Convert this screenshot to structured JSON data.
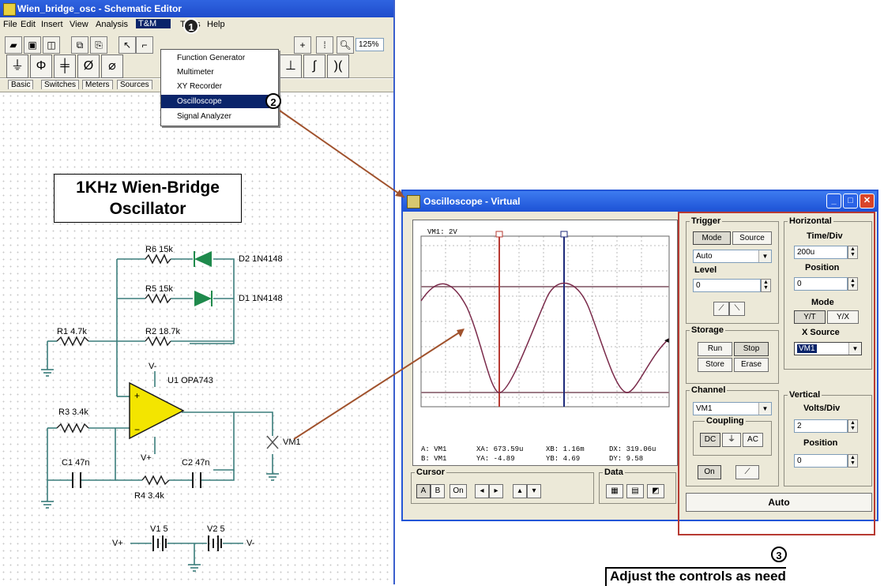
{
  "editor": {
    "title": "Wien_bridge_osc - Schematic Editor",
    "menu": [
      "File",
      "Edit",
      "Insert",
      "View",
      "Analysis",
      "T&M",
      "Tools",
      "Help"
    ],
    "zoom": "125%",
    "tabs": [
      "Basic",
      "Switches",
      "Meters",
      "Sources"
    ],
    "tm_menu": {
      "items": [
        "Function Generator",
        "Multimeter",
        "XY Recorder",
        "Oscilloscope",
        "Signal Analyzer"
      ],
      "selected": "Oscilloscope"
    }
  },
  "schematic": {
    "title_line1": "1KHz Wien-Bridge",
    "title_line2": "Oscillator",
    "labels": {
      "r6": "R6 15k",
      "d2": "D2 1N4148",
      "r5": "R5 15k",
      "d1": "D1 1N4148",
      "r1": "R1 4.7k",
      "r2": "R2 18.7k",
      "vminus": "V-",
      "u1": "U1 OPA743",
      "r3": "R3 3.4k",
      "vm1": "VM1",
      "c1": "C1 47n",
      "vplus": "V+",
      "c2": "C2 47n",
      "r4": "R4 3.4k",
      "v1": "V1 5",
      "v2": "V2 5",
      "vplus_src": "V+",
      "vminus_src": "V-"
    }
  },
  "badges": {
    "b1": "1",
    "b2": "2",
    "b3": "3"
  },
  "oscilloscope": {
    "title": "Oscilloscope - Virtual",
    "screen_label": "VM1: 2V",
    "readouts": {
      "a_ch": "A: VM1",
      "b_ch": "B: VM1",
      "xa": "XA: 673.59u",
      "ya": "YA: -4.89",
      "xb": "XB: 1.16m",
      "yb": "YB: 4.69",
      "dx": "DX: 319.06u",
      "dy": "DY: 9.58"
    },
    "trigger": {
      "title": "Trigger",
      "mode_btn": "Mode",
      "source_btn": "Source",
      "mode_value": "Auto",
      "level_label": "Level",
      "level_value": "0"
    },
    "horizontal": {
      "title": "Horizontal",
      "timediv_label": "Time/Div",
      "timediv_value": "200u",
      "position_label": "Position",
      "position_value": "0",
      "mode_label": "Mode",
      "yt": "Y/T",
      "yx": "Y/X",
      "xsource_label": "X Source",
      "xsource_value": "VM1"
    },
    "storage": {
      "title": "Storage",
      "run": "Run",
      "stop": "Stop",
      "store": "Store",
      "erase": "Erase"
    },
    "channel": {
      "title": "Channel",
      "value": "VM1",
      "coupling_label": "Coupling",
      "dc": "DC",
      "ac": "AC",
      "on": "On"
    },
    "vertical": {
      "title": "Vertical",
      "voltsdiv_label": "Volts/Div",
      "voltsdiv_value": "2",
      "position_label": "Position",
      "position_value": "0"
    },
    "cursor": {
      "title": "Cursor",
      "a": "A",
      "b": "B",
      "on": "On"
    },
    "data": {
      "title": "Data"
    },
    "auto": "Auto"
  },
  "caption": "Adjust the controls as need",
  "colors": {
    "title_blue": "#2456d6",
    "highlight_red": "#b73a32",
    "amp_yellow": "#f3e500",
    "diode_green": "#1f8a4c",
    "wire_teal": "#3a7d7b",
    "arrow_brown": "#a0522d"
  }
}
